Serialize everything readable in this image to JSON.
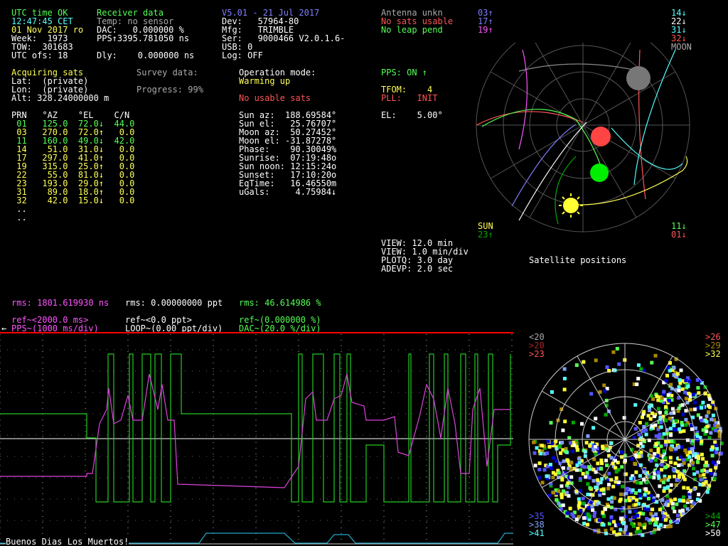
{
  "receiver": {
    "utc_status": "UTC time OK",
    "time": "12:47:45 CET",
    "date": "01 Nov 2017 ro",
    "week": "Week:  1973",
    "tow": "TOW:  301683",
    "utc_ofs": "UTC ofs: 18",
    "title": "Receiver data",
    "temp": "Temp: no sensor",
    "dac": "DAC:   0.000000 %",
    "pps": "PPS↑3395.781050 ns",
    "dly": "Dly:    0.000000 ns"
  },
  "device": {
    "version": "V5.01 - 21 Jul 2017",
    "dev": "Dev:   57964-80",
    "mfg": "Mfg:   TRIMBLE",
    "ser": "Ser:   9000466 V2.0.1.6-",
    "usb": "USB: 0",
    "log": "Log: OFF"
  },
  "status": {
    "antenna": "Antenna unkn",
    "no_sats": "No sats usable",
    "no_leap": "No leap pend",
    "pps_on": "PPS: ON ↑",
    "tfom": "TFOM:    4",
    "pll": "PLL:   INIT",
    "el": "EL:    5.00°"
  },
  "sky_labels": {
    "top_left": [
      {
        "text": "03↑",
        "color": "#7f7fff"
      },
      {
        "text": "17↑",
        "color": "#7f7fff"
      },
      {
        "text": "19↑",
        "color": "#ff55ff"
      }
    ],
    "top_right": [
      {
        "text": "14↓",
        "color": "#55ffff"
      },
      {
        "text": "22↓",
        "color": "#ffffff"
      },
      {
        "text": "31↓",
        "color": "#55ffff"
      },
      {
        "text": "32↓",
        "color": "#ff5555"
      },
      {
        "text": "MOON",
        "color": "#aaaaaa"
      }
    ],
    "bottom_left": [
      {
        "text": "SUN",
        "color": "#ffff55"
      },
      {
        "text": "23↑",
        "color": "#00aa00"
      }
    ],
    "bottom_right": [
      {
        "text": "11↓",
        "color": "#55ff55"
      },
      {
        "text": "01↓",
        "color": "#ff5555"
      }
    ],
    "caption": "Satellite positions"
  },
  "position": {
    "acquiring": "Acquiring sats",
    "lat": "Lat:  (private)",
    "lon": "Lon:  (private)",
    "alt": "Alt: 328.24000000 m",
    "survey": "Survey data:",
    "progress": "Progress: 99%"
  },
  "operation": {
    "mode": "Operation mode:",
    "state": "Warming up",
    "no_usable": "No usable sats"
  },
  "sat_table": {
    "header": "PRN   °AZ    °EL    C/N",
    "rows": [
      {
        "text": " 01   125.0  72.0↓  44.0",
        "color": "#55ff55"
      },
      {
        "text": " 03   270.0  72.0↑   0.0",
        "color": "#ffff55"
      },
      {
        "text": " 11   160.0  49.0↓  42.0",
        "color": "#55ff55"
      },
      {
        "text": " 14    51.0  31.0↓   0.0",
        "color": "#ffff55"
      },
      {
        "text": " 17   297.0  41.0↑   0.0",
        "color": "#ffff55"
      },
      {
        "text": " 19   315.0  25.0↑   0.0",
        "color": "#ffff55"
      },
      {
        "text": " 22    55.0  81.0↓   0.0",
        "color": "#ffff55"
      },
      {
        "text": " 23   193.0  29.0↑   0.0",
        "color": "#ffff55"
      },
      {
        "text": " 31    89.0  18.0↑   0.0",
        "color": "#ffff55"
      },
      {
        "text": " 32    42.0  15.0↓   0.0",
        "color": "#ffff55"
      }
    ],
    "more1": " ..",
    "more2": " .."
  },
  "astro": [
    "Sun az:  188.69584°",
    "Sun el:   25.76707°",
    "Moon az:  50.27452°",
    "Moon el: -31.87278°",
    "Phase:    90.30049%",
    "Sunrise:  07:19:48o",
    "Sun noon: 12:15:24o",
    "Sunset:   17:10:20o",
    "EqTime:   16.46550m",
    "uGals:     4.75984↓"
  ],
  "plot_info": [
    "VIEW: 12.0 min",
    "VIEW: 1.0 min/div",
    "PLOTQ: 3.0 day",
    "ADEVP: 2.0 sec"
  ],
  "rms": {
    "pps": "rms: 1801.619930 ns",
    "loop": "rms: 0.00000000 ppt",
    "dac": "rms: 46.614986 %"
  },
  "legend": {
    "ref_pps": "ref~<2000.0 ms>",
    "pps_div": "PPS~(1000 ms/div)",
    "ref_loop": "ref~<0.0 ppt>",
    "loop_div": "LOOP~(0.00 ppt/div)",
    "ref_dac": "ref~(0.000000 %)",
    "dac_div": "DAC~(20.0 %/div)",
    "left_arrow": "←"
  },
  "map_labels": {
    "tl": [
      {
        "text": "<20",
        "color": "#aaaaaa"
      },
      {
        "text": ">20",
        "color": "#aa2222"
      },
      {
        "text": ">23",
        "color": "#ff5555"
      }
    ],
    "tr": [
      {
        "text": ">26",
        "color": "#ff5555"
      },
      {
        "text": ">29",
        "color": "#aa8800"
      },
      {
        "text": ">32",
        "color": "#ffff55"
      }
    ],
    "bl": [
      {
        "text": ">35",
        "color": "#5555ff"
      },
      {
        "text": ">38",
        "color": "#7f9fff"
      },
      {
        "text": ">41",
        "color": "#55ffff"
      }
    ],
    "br": [
      {
        "text": ">44",
        "color": "#00aa00"
      },
      {
        "text": ">47",
        "color": "#55ff55"
      },
      {
        "text": ">50",
        "color": "#ffffff"
      }
    ]
  },
  "footer_msg": "Buenos Dias Los Muertos!"
}
